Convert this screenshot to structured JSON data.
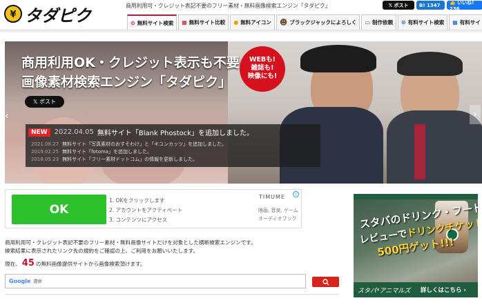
{
  "header": {
    "logo_text": "タダピク",
    "tagline": "商用利用可・クレジット表記不要のフリー素材・無料画像検索エンジン「タダピク」",
    "share": {
      "x_label": "𝕏 ポスト",
      "hatena_label": "B! 1347",
      "fb_label": "👍 いいね! 236"
    }
  },
  "nav": {
    "tabs": [
      {
        "label": "無料サイト検索",
        "icon": "search-icon"
      },
      {
        "label": "無料サイト比較",
        "icon": "grid-icon"
      },
      {
        "label": "無料アイコン",
        "icon": "coin-icon"
      },
      {
        "label": "ブラックジャックによろしく",
        "icon": "avatar-icon"
      },
      {
        "label": "制作依頼",
        "icon": "monitor-icon"
      },
      {
        "label": "有料サイト検索",
        "icon": "search-icon"
      },
      {
        "label": "有料サイト比較",
        "icon": "grid-icon"
      }
    ]
  },
  "hero": {
    "title_line1": "商用利用OK・クレジット表示も不要の",
    "title_line2": "画像素材検索エンジン「タダピク」",
    "badge_lines": [
      "WEBも!",
      "雑誌も!",
      "映像にも!"
    ],
    "x_post_label": "𝕏 ポスト",
    "news_new": "NEW",
    "news_headline_date": "2022.04.05",
    "news_headline": "無料サイト「Blank Phostock」を追加しました。",
    "news_items": [
      {
        "date": "2021.08.27",
        "text": "無料サイト「写真素材のおすそわけ」と「キユンカッツ」を追加しました。"
      },
      {
        "date": "2019.02.25",
        "text": "無料サイト「fotoma」を追加しました。"
      },
      {
        "date": "2018.05.23",
        "text": "無料サイト「フリー素材ドットコム」の情報を更新しました。"
      }
    ]
  },
  "ad": {
    "ok_label": "OK",
    "steps": [
      "1. OKをクリックします",
      "2. アカウントをアクティベート",
      "3. コンテンツにアクセス"
    ],
    "brand": "TIMUME",
    "sub_lines": [
      "映画, 音楽, ゲーム",
      "オーディオブック"
    ],
    "info_label": "i"
  },
  "body": {
    "description_line1": "商用利用可・クレジット表記不要のフリー素材・無料画像サイトだけを対象とした横断検索エンジンです。",
    "description_line2": "検索結果に表示されたリンク先の規約をご確認の上、ご利用をお願いいたします。",
    "count_prefix": "現在、",
    "count_value": "45",
    "count_suffix": "の無料画像提供サイトから画像検索頂けます。",
    "search_brand": "Google",
    "search_placeholder": "提供",
    "search_button_icon": "search-icon"
  },
  "side_ad": {
    "line1": "スタバのドリンク・フードの",
    "line2a": "レビューで",
    "line2b": "ドリンクチケット",
    "line3": "500円ゲット!!!",
    "brand": "スタバ*アニマルズ",
    "more_label": "詳しくはこちら ›"
  },
  "colors": {
    "accent_red": "#c8102e",
    "ok_green": "#2cc12c",
    "side_green": "#1f5c40"
  }
}
